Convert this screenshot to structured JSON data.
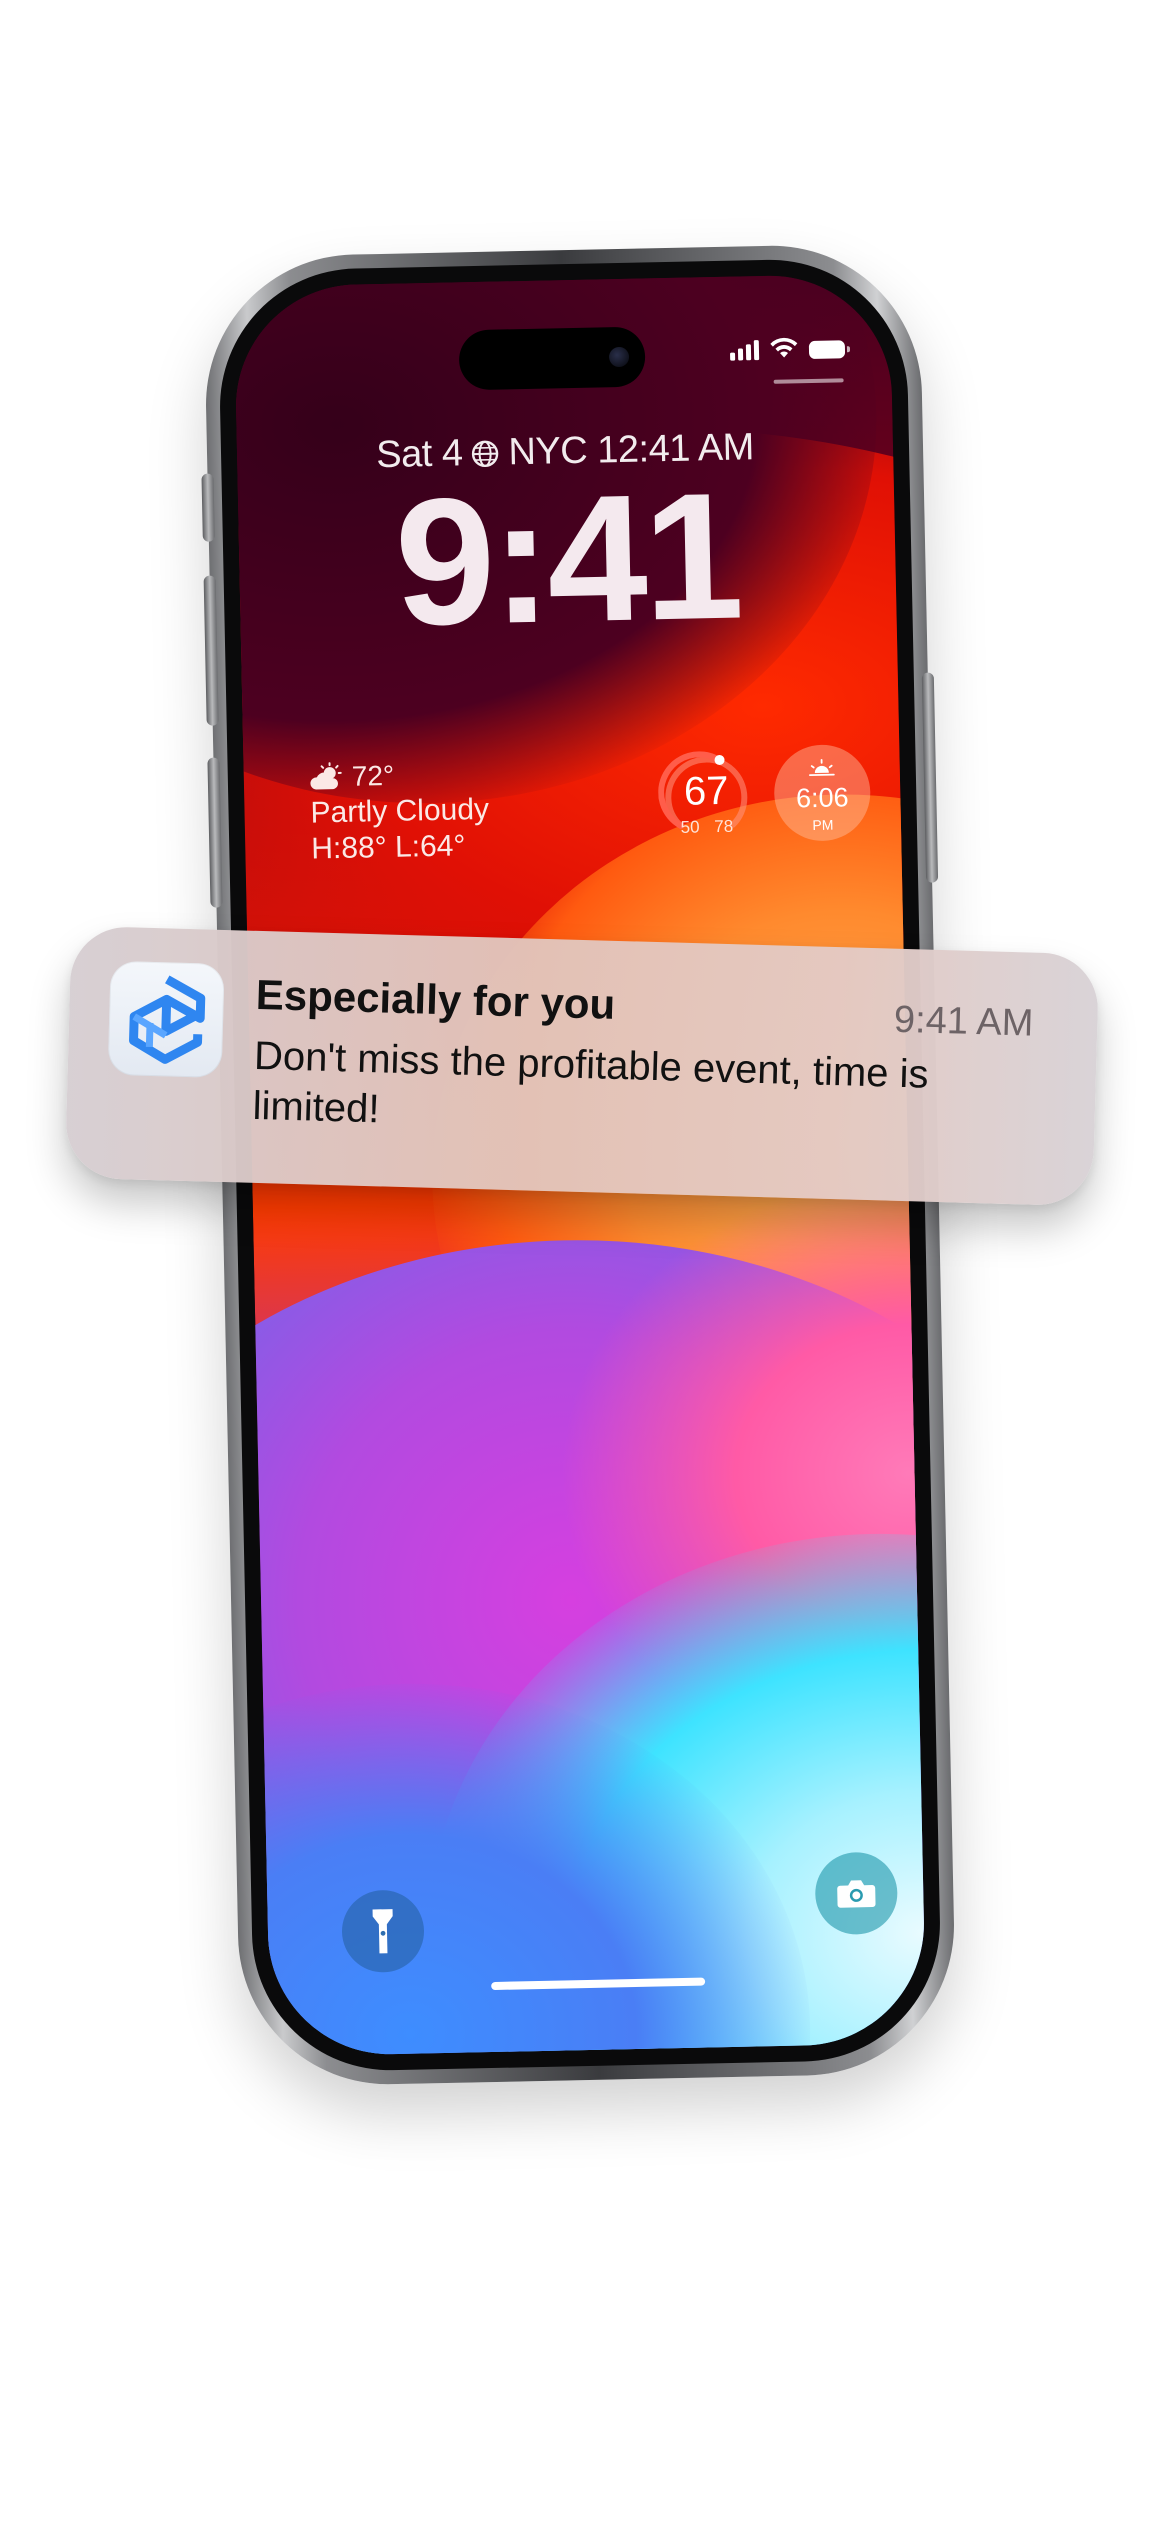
{
  "status_bar": {
    "icons": [
      "cellular-signal-icon",
      "wifi-icon",
      "battery-icon"
    ]
  },
  "lock_screen": {
    "date": "Sat 4",
    "world_clock": "NYC 12:41 AM",
    "time": "9:41"
  },
  "widgets": {
    "weather": {
      "temperature": "72°",
      "condition": "Partly Cloudy",
      "high_low": "H:88° L:64°",
      "icon": "partly-cloudy-icon"
    },
    "temperature_ring": {
      "value": "67",
      "min": "50",
      "max": "78"
    },
    "sunset": {
      "time": "6:06",
      "period": "PM",
      "icon": "sunset-icon"
    }
  },
  "controls": {
    "left": "flashlight-icon",
    "right": "camera-icon"
  },
  "notification": {
    "title": "Especially for you",
    "time": "9:41 AM",
    "body": "Don't miss the profitable event, time is limited!",
    "icon": "app-logo-icon",
    "accent": "#2f86f0"
  }
}
